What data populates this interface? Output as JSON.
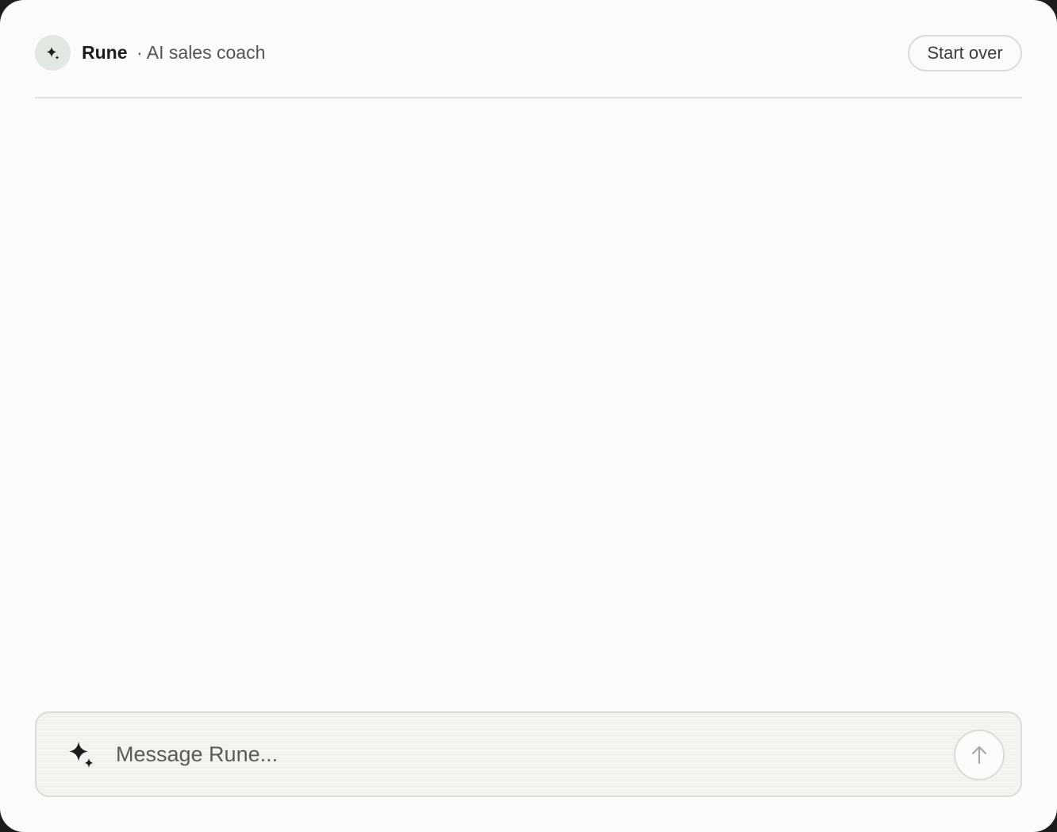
{
  "header": {
    "avatar_icon": "sparkle-icon",
    "app_name": "Rune",
    "subtitle": "· AI sales coach",
    "start_over_label": "Start over"
  },
  "composer": {
    "icon": "sparkles-icon",
    "placeholder": "Message Rune...",
    "value": "",
    "send_icon": "arrow-up-icon"
  },
  "colors": {
    "background": "#fbfbf9",
    "avatar_bg": "#e3e7e1",
    "border": "#dcdcd7",
    "text_primary": "#1d1d1b",
    "text_secondary": "#55554f",
    "send_arrow": "#a8a8a3"
  }
}
